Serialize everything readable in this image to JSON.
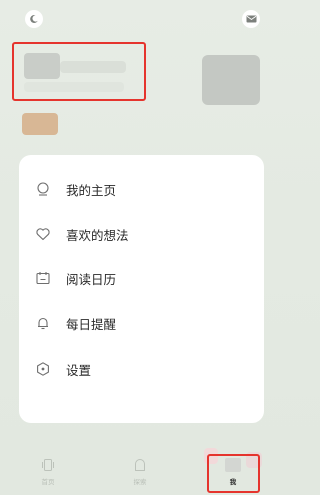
{
  "header": {
    "night_mode_icon": "moon-icon",
    "mail_icon": "mail-icon"
  },
  "menu": [
    {
      "icon": "profile-icon",
      "label": "我的主页"
    },
    {
      "icon": "heart-icon",
      "label": "喜欢的想法"
    },
    {
      "icon": "calendar-icon",
      "label": "阅读日历"
    },
    {
      "icon": "bell-icon",
      "label": "每日提醒"
    },
    {
      "icon": "settings-icon",
      "label": "设置"
    }
  ],
  "tabs": [
    {
      "icon": "home-icon",
      "label": "首页"
    },
    {
      "icon": "explore-icon",
      "label": "探索"
    },
    {
      "icon": "me-icon",
      "label": "我"
    }
  ],
  "colors": {
    "highlight": "#e5342d",
    "background": "#e5ebe3",
    "card": "#ffffff"
  }
}
